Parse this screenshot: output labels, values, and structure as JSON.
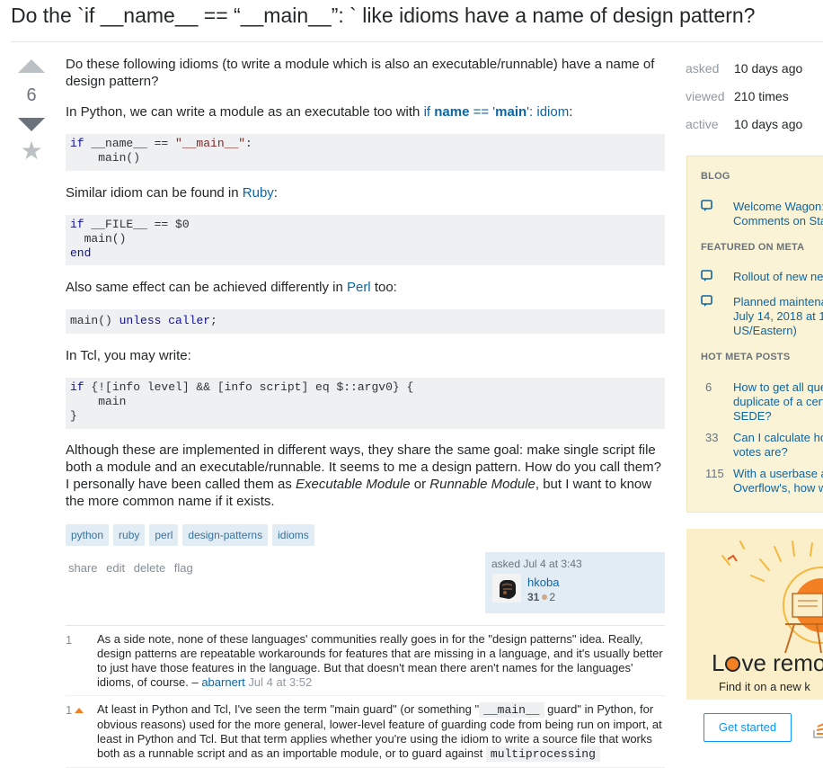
{
  "question": {
    "title": "Do the `if __name__ == “__main__”: ` like idioms have a name of design pattern?",
    "votes": "6",
    "intro": "Do these following idioms (to write a module which is also an executable/runnable) have a name of design pattern?",
    "python_prefix": "In Python, we can write a module as an executable too with ",
    "python_link_a": "if ",
    "python_link_name": "name",
    "python_link_b": " == '",
    "python_link_main": "main",
    "python_link_c": "': idiom",
    "python_suffix": ":",
    "ruby_prefix": "Similar idiom can be found in ",
    "ruby_link": "Ruby",
    "ruby_suffix": ":",
    "perl_prefix": "Also same effect can be achieved differently in ",
    "perl_link": "Perl",
    "perl_suffix": " too:",
    "tcl_text": "In Tcl, you may write:",
    "closing_1": "Although these are implemented in different ways, they share the same goal: make single script file both a module and an executable/runnable. It seems to me a design pattern. How do you call them? I personally have been called them as ",
    "closing_em1": "Executable Module",
    "closing_or": " or ",
    "closing_em2": "Runnable Module",
    "closing_2": ", but I want to know the more common name if it exists.",
    "code_python": {
      "l1_kw": "if",
      "l1_mid": " __name__ == ",
      "l1_str": "\"__main__\"",
      "l1_end": ":",
      "l2": "    main()"
    },
    "code_ruby": {
      "l1_kw": "if",
      "l1_rest": " __FILE__ == $0",
      "l2": "  main()",
      "l3_kw": "end"
    },
    "code_perl": {
      "a": "main() ",
      "kw1": "unless",
      "b": " ",
      "kw2": "caller",
      "c": ";"
    },
    "code_tcl": {
      "l1_kw": "if",
      "l1_rest": " {![info level] && [info script] eq $::argv0} {",
      "l2": "    main",
      "l3": "}"
    },
    "tags": [
      "python",
      "ruby",
      "perl",
      "design-patterns",
      "idioms"
    ],
    "menu": [
      "share",
      "edit",
      "delete",
      "flag"
    ],
    "owner": {
      "asked": "asked Jul 4 at 3:43",
      "name": "hkoba",
      "rep": "31",
      "bronze": "2"
    }
  },
  "comments": [
    {
      "score": "1",
      "text": "As a side note, none of these languages' communities really goes in for the \"design patterns\" idea. Really, design patterns are repeatable workarounds for features that are missing in a language, and it's usually better to just have those features in the language. But that doesn't mean there aren't names for the languages' idioms, of course. – ",
      "user": "abarnert",
      "date": "Jul 4 at 3:52"
    },
    {
      "score": "1",
      "text_a": "At least in Python and Tcl, I've seen the term \"main guard\" (or something \"",
      "code": "__main__",
      "text_b": " guard\" in Python, for obvious reasons) used for the more general, lower-level feature of guarding code from being run on import, at least in Python and Tcl. But that term applies whether you're using the idiom to write a source file that works both as a runnable script and as an importable module, or to guard against ",
      "code2": "multiprocessing"
    }
  ],
  "stats": [
    {
      "label": "asked",
      "value": "10 days ago"
    },
    {
      "label": "viewed",
      "value": "210 times"
    },
    {
      "label": "active",
      "value": "10 days ago"
    }
  ],
  "meta": {
    "blog_head": "BLOG",
    "blog_items": [
      "Welcome Wagon:",
      "Comments on Sta"
    ],
    "featured_head": "FEATURED ON META",
    "featured_1": "Rollout of new ne",
    "featured_2": [
      "Planned maintena",
      "July 14, 2018 at 1",
      "US/Eastern)"
    ],
    "hot_head": "HOT META POSTS",
    "hot": [
      {
        "n": "6",
        "lines": [
          "How to get all que",
          "duplicate of a cert",
          "SEDE?"
        ]
      },
      {
        "n": "33",
        "lines": [
          "Can I calculate ho",
          "votes are?"
        ]
      },
      {
        "n": "115",
        "lines": [
          "With a userbase a",
          "Overflow's, how w"
        ]
      }
    ]
  },
  "ad": {
    "headline_a": "L",
    "headline_b": "ve remo",
    "sub": "Find it on a new k",
    "button": "Get started"
  },
  "colors": {
    "accent": "#0c65a5",
    "tag_bg": "#e1ecf4",
    "tag_fg": "#39739d",
    "orange": "#f48024",
    "meta_bg": "#fbf3d5"
  }
}
